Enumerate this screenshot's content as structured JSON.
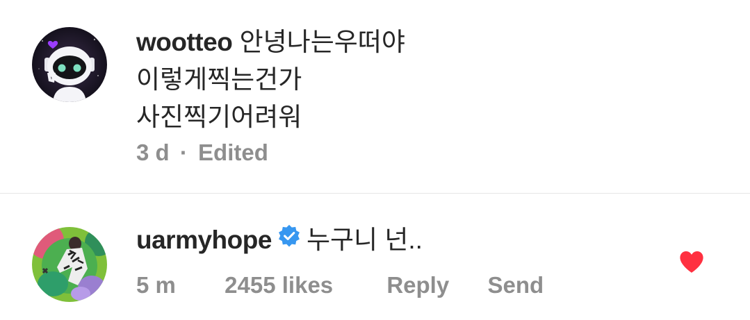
{
  "comments": [
    {
      "username": "wootteo",
      "text_line1": "안녕나는우떠야",
      "text_line2": "이렇게찍는건가",
      "text_line3": "사진찍기어려워",
      "time": "3 d",
      "separator": "·",
      "edited": "Edited",
      "avatar_icon": "robot-avatar-icon"
    },
    {
      "username": "uarmyhope",
      "verified": true,
      "text": "누구니 넌..",
      "time": "5 m",
      "likes": "2455 likes",
      "reply_label": "Reply",
      "send_label": "Send",
      "liked": true,
      "avatar_icon": "artwork-avatar-icon"
    }
  ],
  "colors": {
    "text_primary": "#262626",
    "text_secondary": "#8e8e8e",
    "verified_blue": "#3797f0",
    "like_red": "#ff3040",
    "divider": "#e6e6e6"
  }
}
